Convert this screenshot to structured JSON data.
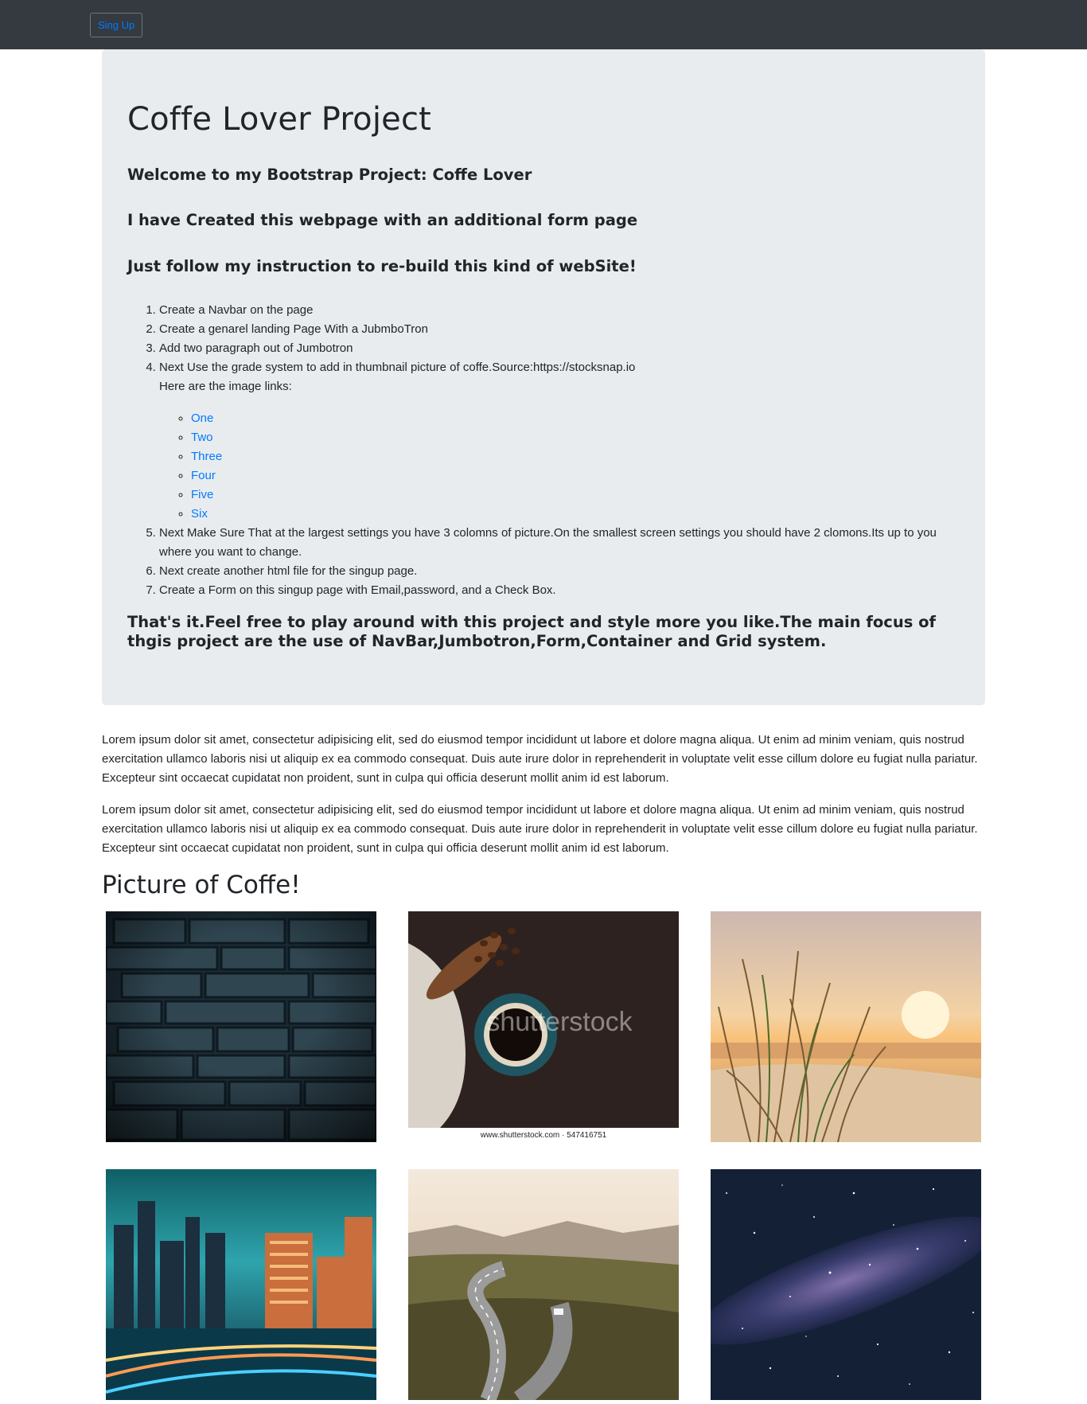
{
  "navbar": {
    "signup_label": "Sing Up"
  },
  "jumbotron": {
    "title": "Coffe Lover Project",
    "subtitles": [
      "Welcome to my Bootstrap Project: Coffe Lover",
      "I have Created this webpage with an additional form page",
      "Just follow my instruction to re-build this kind of webSite!"
    ],
    "steps": [
      "Create a Navbar on the page",
      "Create a genarel landing Page With a JubmboTron",
      "Add two paragraph out of Jumbotron",
      "Next Use the grade system to add in thumbnail picture of coffe.Source:https://stocksnap.io",
      "Next Make Sure That at the largest settings you have 3 colomns of picture.On the smallest screen settings you should have 2 clomons.Its up to you where you want to change.",
      "Next create another html file for the singup page.",
      "Create a Form on this singup page with Email,password, and a Check Box."
    ],
    "image_links_intro": "Here are the image links:",
    "image_links": [
      "One",
      "Two",
      "Three",
      "Four",
      "Five",
      "Six"
    ],
    "outro": "That's it.Feel free to play around with this project and style more you like.The main focus of thgis project are the use of NavBar,Jumbotron,Form,Container and Grid system."
  },
  "paragraphs": [
    "Lorem ipsum dolor sit amet, consectetur adipisicing elit, sed do eiusmod tempor incididunt ut labore et dolore magna aliqua. Ut enim ad minim veniam, quis nostrud exercitation ullamco laboris nisi ut aliquip ex ea commodo consequat. Duis aute irure dolor in reprehenderit in voluptate velit esse cillum dolore eu fugiat nulla pariatur. Excepteur sint occaecat cupidatat non proident, sunt in culpa qui officia deserunt mollit anim id est laborum.",
    "Lorem ipsum dolor sit amet, consectetur adipisicing elit, sed do eiusmod tempor incididunt ut labore et dolore magna aliqua. Ut enim ad minim veniam, quis nostrud exercitation ullamco laboris nisi ut aliquip ex ea commodo consequat. Duis aute irure dolor in reprehenderit in voluptate velit esse cillum dolore eu fugiat nulla pariatur. Excepteur sint occaecat cupidatat non proident, sunt in culpa qui officia deserunt mollit anim id est laborum."
  ],
  "pictures": {
    "title": "Picture of Coffe!",
    "watermark": "shutterstock",
    "caption": "www.shutterstock.com · 547416751"
  },
  "colors": {
    "navbar": "#343a40",
    "jumbotron": "#e9ecef",
    "link": "#007bff"
  }
}
